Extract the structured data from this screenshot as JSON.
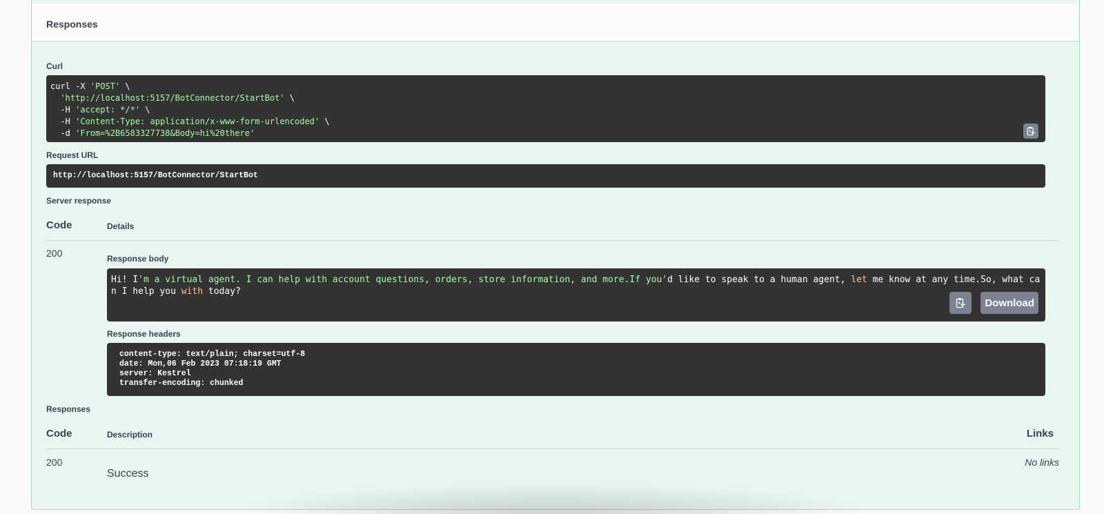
{
  "section": {
    "title": "Responses"
  },
  "curl": {
    "label": "Curl",
    "lines": [
      {
        "plain1": "curl -X ",
        "str": "'POST'",
        "plain2": " \\"
      },
      {
        "plain1": "  ",
        "str": "'http://localhost:5157/BotConnector/StartBot'",
        "plain2": " \\"
      },
      {
        "plain1": "  -H ",
        "str": "'accept: */*'",
        "plain2": " \\"
      },
      {
        "plain1": "  -H ",
        "str": "'Content-Type: application/x-www-form-urlencoded'",
        "plain2": " \\"
      },
      {
        "plain1": "  -d ",
        "str": "'From=%2B6583327738&Body=hi%20there'",
        "plain2": ""
      }
    ],
    "copy_icon": "clipboard-copy-icon"
  },
  "request_url": {
    "label": "Request URL",
    "value": "http://localhost:5157/BotConnector/StartBot"
  },
  "server_response": {
    "label": "Server response",
    "columns": {
      "code": "Code",
      "details": "Details"
    },
    "code": "200",
    "body_label": "Response body",
    "body_segments": [
      {
        "t": "Hi! I",
        "c": "plain"
      },
      {
        "t": "'m a virtual agent. I can help with account questions, orders, store information, and more.If you'",
        "c": "str"
      },
      {
        "t": "d like to speak to a human agent, ",
        "c": "plain"
      },
      {
        "t": "let",
        "c": "kw"
      },
      {
        "t": " me know at any time.So, what can I help you ",
        "c": "plain"
      },
      {
        "t": "with",
        "c": "kw"
      },
      {
        "t": " today?",
        "c": "plain"
      }
    ],
    "download_label": "Download",
    "headers_label": "Response headers",
    "headers": [
      "content-type: text/plain; charset=utf-8",
      "date: Mon,06 Feb 2023 07:18:19 GMT",
      "server: Kestrel",
      "transfer-encoding: chunked"
    ]
  },
  "responses": {
    "label": "Responses",
    "columns": {
      "code": "Code",
      "description": "Description",
      "links": "Links"
    },
    "rows": [
      {
        "code": "200",
        "description": "Success",
        "links": "No links"
      }
    ]
  },
  "colors": {
    "block_bg": "#e8f6f0",
    "block_border": "#a6dcc0",
    "code_bg": "#333333",
    "string": "#a2fca2",
    "keyword": "#fcc28c",
    "button": "#7d8293"
  }
}
